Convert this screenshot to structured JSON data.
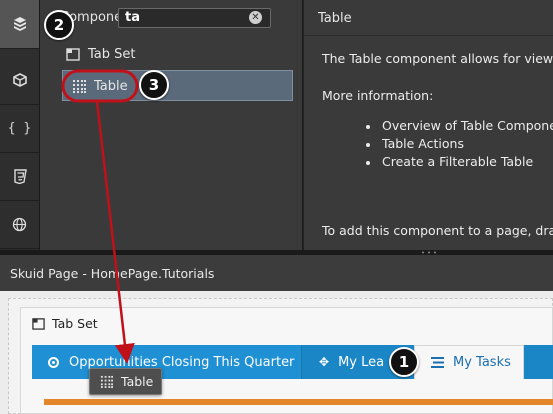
{
  "rail": {
    "items": [
      {
        "name": "components",
        "icon": "cube-stack-icon",
        "active": true
      },
      {
        "name": "page-builder",
        "icon": "box-icon",
        "active": false
      },
      {
        "name": "javascript",
        "icon": "braces-icon",
        "glyph": "{ }",
        "active": false
      },
      {
        "name": "css",
        "icon": "css3-icon",
        "active": false
      },
      {
        "name": "web",
        "icon": "globe-icon",
        "active": false
      }
    ]
  },
  "components_panel": {
    "label": "Componen",
    "search_value": "ta",
    "items": [
      "Tab Set",
      "Table"
    ]
  },
  "help_panel": {
    "title": "Table",
    "intro": "The Table component allows for view",
    "more_info": "More information:",
    "links": [
      "Overview of Table Compone",
      "Table Actions",
      "Create a Filterable Table"
    ],
    "footer": "To add this component to a page, dra"
  },
  "page": {
    "title": "Skuid Page - HomePage.Tutorials",
    "tabset_label": "Tab Set",
    "tabs": [
      "Opportunities Closing This Quarter",
      "My Lea",
      "My Tasks"
    ],
    "drag_label": "Table"
  },
  "callouts": [
    "1",
    "2",
    "3"
  ],
  "colors": {
    "accent": "#1b86c6",
    "highlight": "#c0111a",
    "orange": "#e4872a"
  }
}
